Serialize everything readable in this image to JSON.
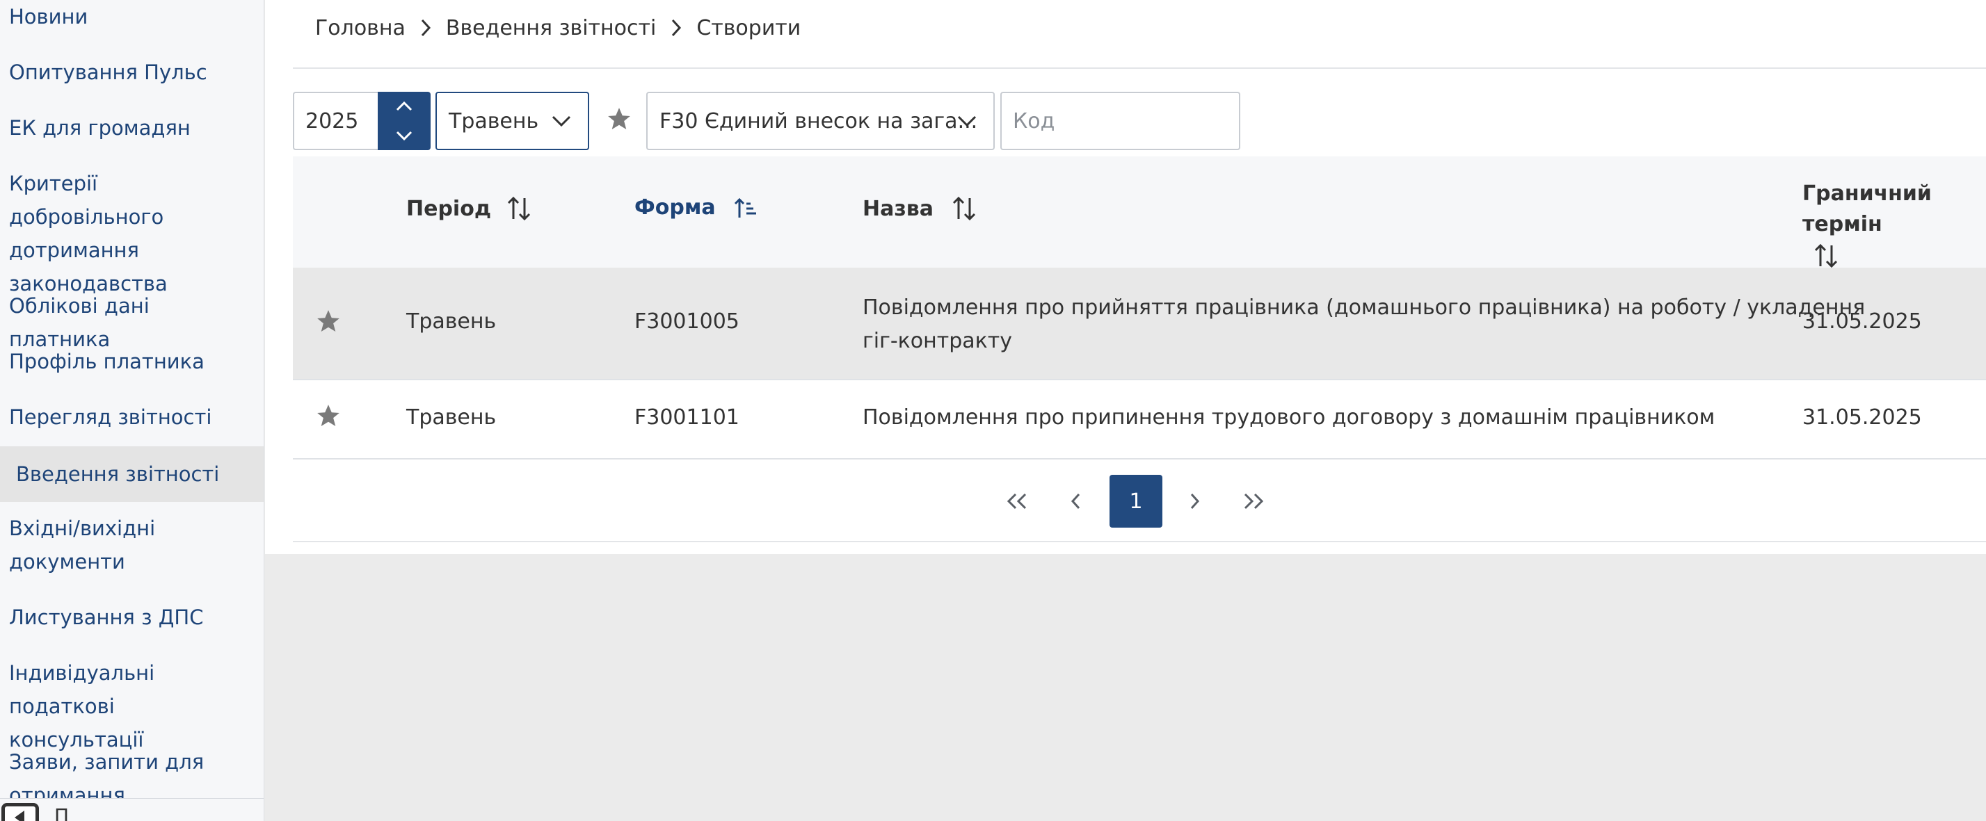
{
  "sidebar": {
    "items": [
      {
        "label": "Новини"
      },
      {
        "label": "Опитування Пульс"
      },
      {
        "label": "ЕК для громадян"
      },
      {
        "label": "Критерії добровільного дотримання законодавства"
      },
      {
        "label": "Облікові дані платника"
      },
      {
        "label": "Профіль платника"
      },
      {
        "label": "Перегляд звітності"
      },
      {
        "label": "Введення звітності"
      },
      {
        "label": "Вхідні/вихідні документи"
      },
      {
        "label": "Листування з ДПС"
      },
      {
        "label": "Індивідуальні податкові консультації"
      },
      {
        "label": "Заяви, запити для отримання інформації"
      }
    ],
    "active_item": "Введення звітності",
    "collapse_label": "П"
  },
  "breadcrumb": [
    "Головна",
    "Введення звітності",
    "Створити"
  ],
  "filters": {
    "year_value": "2025",
    "month_value": "Травень",
    "form_value": "F30 Єдиний внесок на зага...",
    "code_placeholder": "Код"
  },
  "table": {
    "columns": [
      "Період",
      "Форма",
      "Назва",
      "Граничний термін"
    ],
    "sorted_column": "Форма",
    "rows": [
      {
        "period": "Травень",
        "form": "F3001005",
        "name_line1": "Повідомлення про прийняття працівника (домашнього працівника) на роботу / укладення",
        "name_line2": "гіг-контракту",
        "deadline": "31.05.2025"
      },
      {
        "period": "Травень",
        "form": "F3001101",
        "name_line1": "Повідомлення про припинення трудового договору з домашнім працівником",
        "deadline": "31.05.2025"
      }
    ]
  },
  "pagination": {
    "current_page": "1"
  },
  "colors": {
    "accent": "#224a7f",
    "link": "#1e4478",
    "star": "#7a7a7a"
  }
}
